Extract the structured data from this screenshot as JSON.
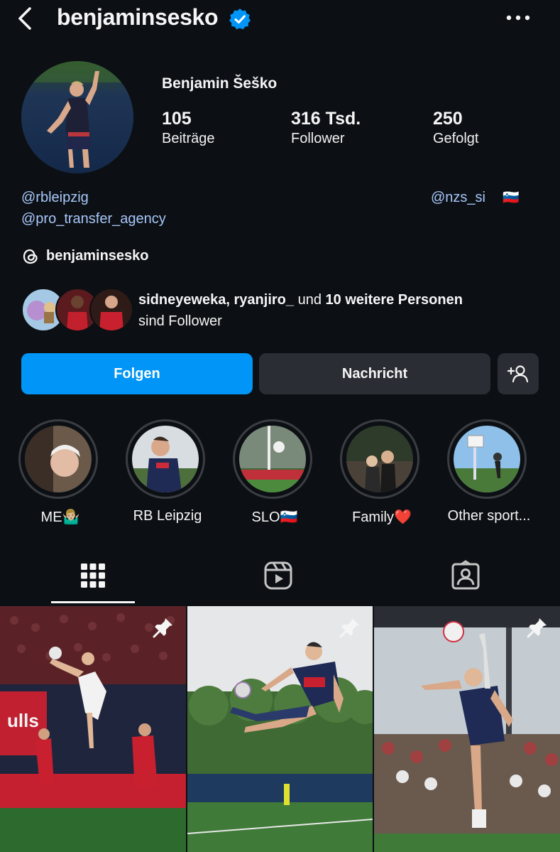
{
  "header": {
    "username": "benjaminsesko",
    "verified": true,
    "back_icon": "chevron-left-icon",
    "more_icon": "more-horizontal-icon"
  },
  "profile": {
    "full_name": "Benjamin Šeško",
    "stats": [
      {
        "value": "105",
        "label": "Beiträge"
      },
      {
        "value": "316 Tsd.",
        "label": "Follower"
      },
      {
        "value": "250",
        "label": "Gefolgt"
      }
    ],
    "links": {
      "link1": "@rbleipzig",
      "link2": "@pro_transfer_agency",
      "link3": "@nzs_si",
      "flag": "🇸🇮"
    },
    "threads": {
      "icon": "threads-icon",
      "name": "benjaminsesko"
    },
    "followed_by": {
      "names": "sidneyeweka, ryanjiro_",
      "connector": "und",
      "others": "10 weitere Personen",
      "suffix": "sind Follower"
    }
  },
  "actions": {
    "follow_label": "Folgen",
    "message_label": "Nachricht",
    "add_user_icon": "add-user-icon",
    "colors": {
      "follow": "#0095f6",
      "secondary": "#2a2d33"
    }
  },
  "highlights": [
    {
      "label": "ME🤷🏼‍♂️"
    },
    {
      "label": "RB Leipzig"
    },
    {
      "label": "SLO🇸🇮"
    },
    {
      "label": "Family❤️"
    },
    {
      "label": "Other sport..."
    }
  ],
  "tabs": [
    {
      "icon": "grid-icon",
      "active": true
    },
    {
      "icon": "reels-icon",
      "active": false
    },
    {
      "icon": "tagged-icon",
      "active": false
    }
  ],
  "posts": [
    {
      "pinned": true
    },
    {
      "pinned": true
    },
    {
      "pinned": true
    }
  ]
}
